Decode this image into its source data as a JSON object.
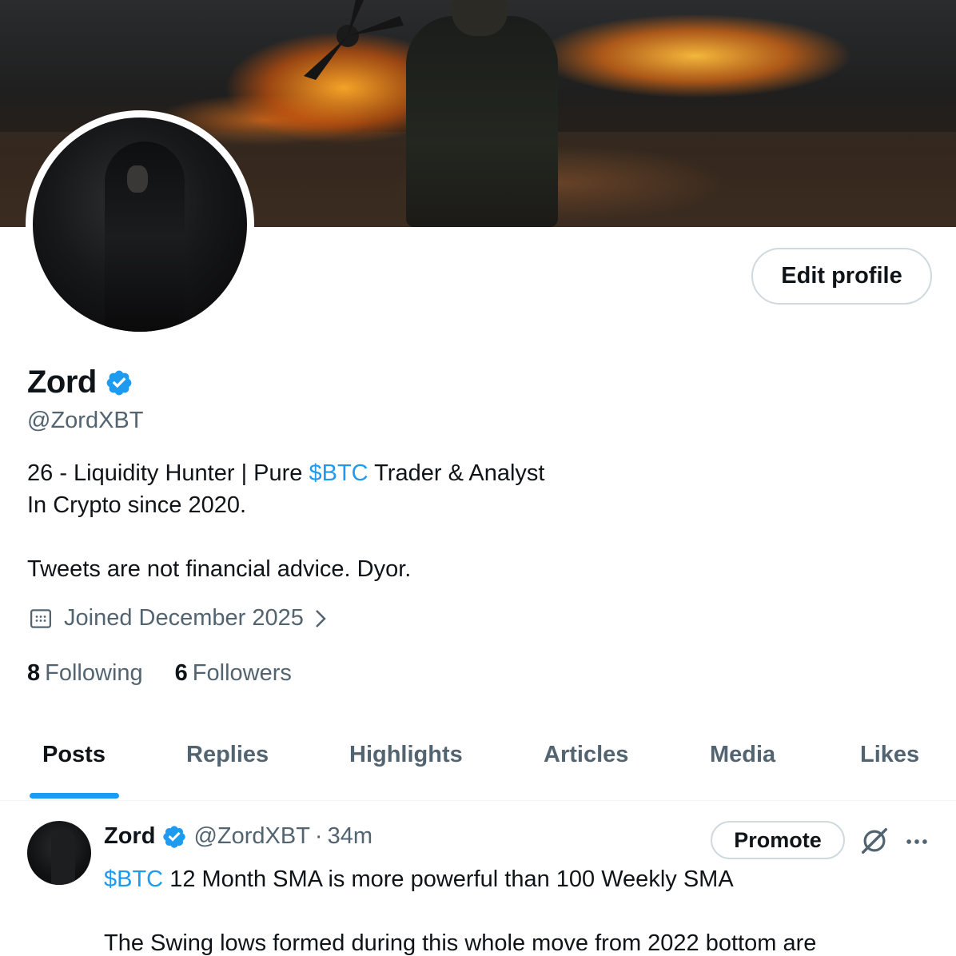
{
  "profile": {
    "name": "Zord",
    "handle": "@ZordXBT",
    "bio_line1_pre": "26 - Liquidity Hunter | Pure ",
    "bio_line1_cash": "$BTC",
    "bio_line1_post": " Trader & Analyst",
    "bio_line2": "In Crypto since 2020.",
    "bio_line3": "Tweets are not financial advice. Dyor.",
    "joined": "Joined December 2025",
    "following_count": "8",
    "following_label": "Following",
    "followers_count": "6",
    "followers_label": "Followers"
  },
  "actions": {
    "edit_profile": "Edit profile",
    "promote": "Promote"
  },
  "tabs": [
    {
      "label": "Posts",
      "active": true
    },
    {
      "label": "Replies",
      "active": false
    },
    {
      "label": "Highlights",
      "active": false
    },
    {
      "label": "Articles",
      "active": false
    },
    {
      "label": "Media",
      "active": false
    },
    {
      "label": "Likes",
      "active": false
    }
  ],
  "post": {
    "author": "Zord",
    "handle": "@ZordXBT",
    "separator": "·",
    "time": "34m",
    "text_line1_cash": "$BTC",
    "text_line1_rest": " 12 Month SMA is more powerful than 100 Weekly SMA",
    "text_line2": "The Swing lows formed during this whole move from 2022 bottom are"
  },
  "icons": {
    "verified": "verified-badge-icon",
    "calendar": "calendar-icon",
    "chevron": "chevron-right-icon",
    "grok": "grok-icon",
    "more": "more-options-icon"
  },
  "colors": {
    "accent": "#1d9bf0",
    "text_primary": "#0f1419",
    "text_secondary": "#536471",
    "border": "#cfd9de"
  }
}
